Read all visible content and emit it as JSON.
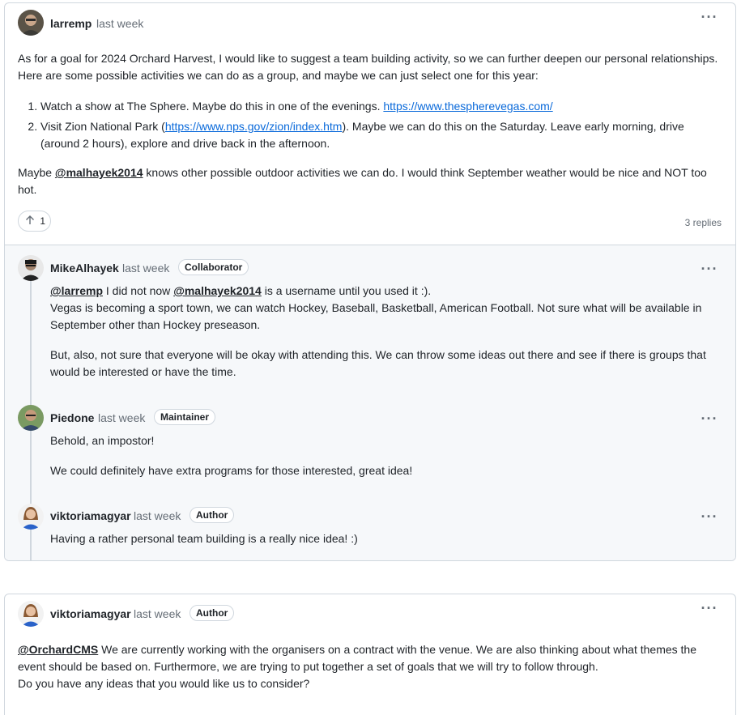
{
  "main_comment": {
    "author": "larremp",
    "time": "last week",
    "para1": "As for a goal for 2024 Orchard Harvest, I would like to suggest a team building activity, so we can further deepen our personal relationships. Here are some possible activities we can do as a group, and maybe we can just select one for this year:",
    "item1_text": "Watch a show at The Sphere. Maybe do this in one of the evenings.",
    "item1_link": "https://www.thespherevegas.com/",
    "item2_pre": "Visit Zion National Park (",
    "item2_link": "https://www.nps.gov/zion/index.htm",
    "item2_post": "). Maybe we can do this on the Saturday. Leave early morning, drive (around 2 hours), explore and drive back in the afternoon.",
    "para2_pre": "Maybe ",
    "para2_mention": "@malhayek2014",
    "para2_post": " knows other possible outdoor activities we can do. I would think September weather would be nice and NOT too hot.",
    "reaction_count": "1",
    "replies_label": "3 replies"
  },
  "replies": [
    {
      "author": "MikeAlhayek",
      "time": "last week",
      "badge": "Collaborator",
      "mention1": "@larremp",
      "text1": " I did not now ",
      "mention2": "@malhayek2014",
      "text2": " is a username until you used it :).",
      "line2": "Vegas is becoming a sport town, we can watch Hockey, Baseball, Basketball, American Football. Not sure what will be available in September other than Hockey preseason.",
      "para2": "But, also, not sure that everyone will be okay with attending this. We can throw some ideas out there and see if there is groups that would be interested or have the time."
    },
    {
      "author": "Piedone",
      "time": "last week",
      "badge": "Maintainer",
      "para1": "Behold, an impostor!",
      "para2": "We could definitely have extra programs for those interested, great idea!"
    },
    {
      "author": "viktoriamagyar",
      "time": "last week",
      "badge": "Author",
      "para1": "Having a rather personal team building is a really nice idea! :)"
    }
  ],
  "second_comment": {
    "author": "viktoriamagyar",
    "time": "last week",
    "badge": "Author",
    "mention": "@OrchardCMS",
    "text1": " We are currently working with the organisers on a contract with the venue. We are also thinking about what themes the event should be based on. Furthermore, we are trying to put together a set of goals that we will try to follow through.",
    "text2": "Do you have any ideas that you would like us to consider?"
  },
  "icons": {
    "kebab": "kebab-horizontal-icon",
    "upvote": "arrow-up-icon"
  },
  "colors": {
    "link": "#0969da",
    "muted": "#656d76",
    "border": "#d0d7de",
    "reply_bg": "#f6f8fa"
  }
}
